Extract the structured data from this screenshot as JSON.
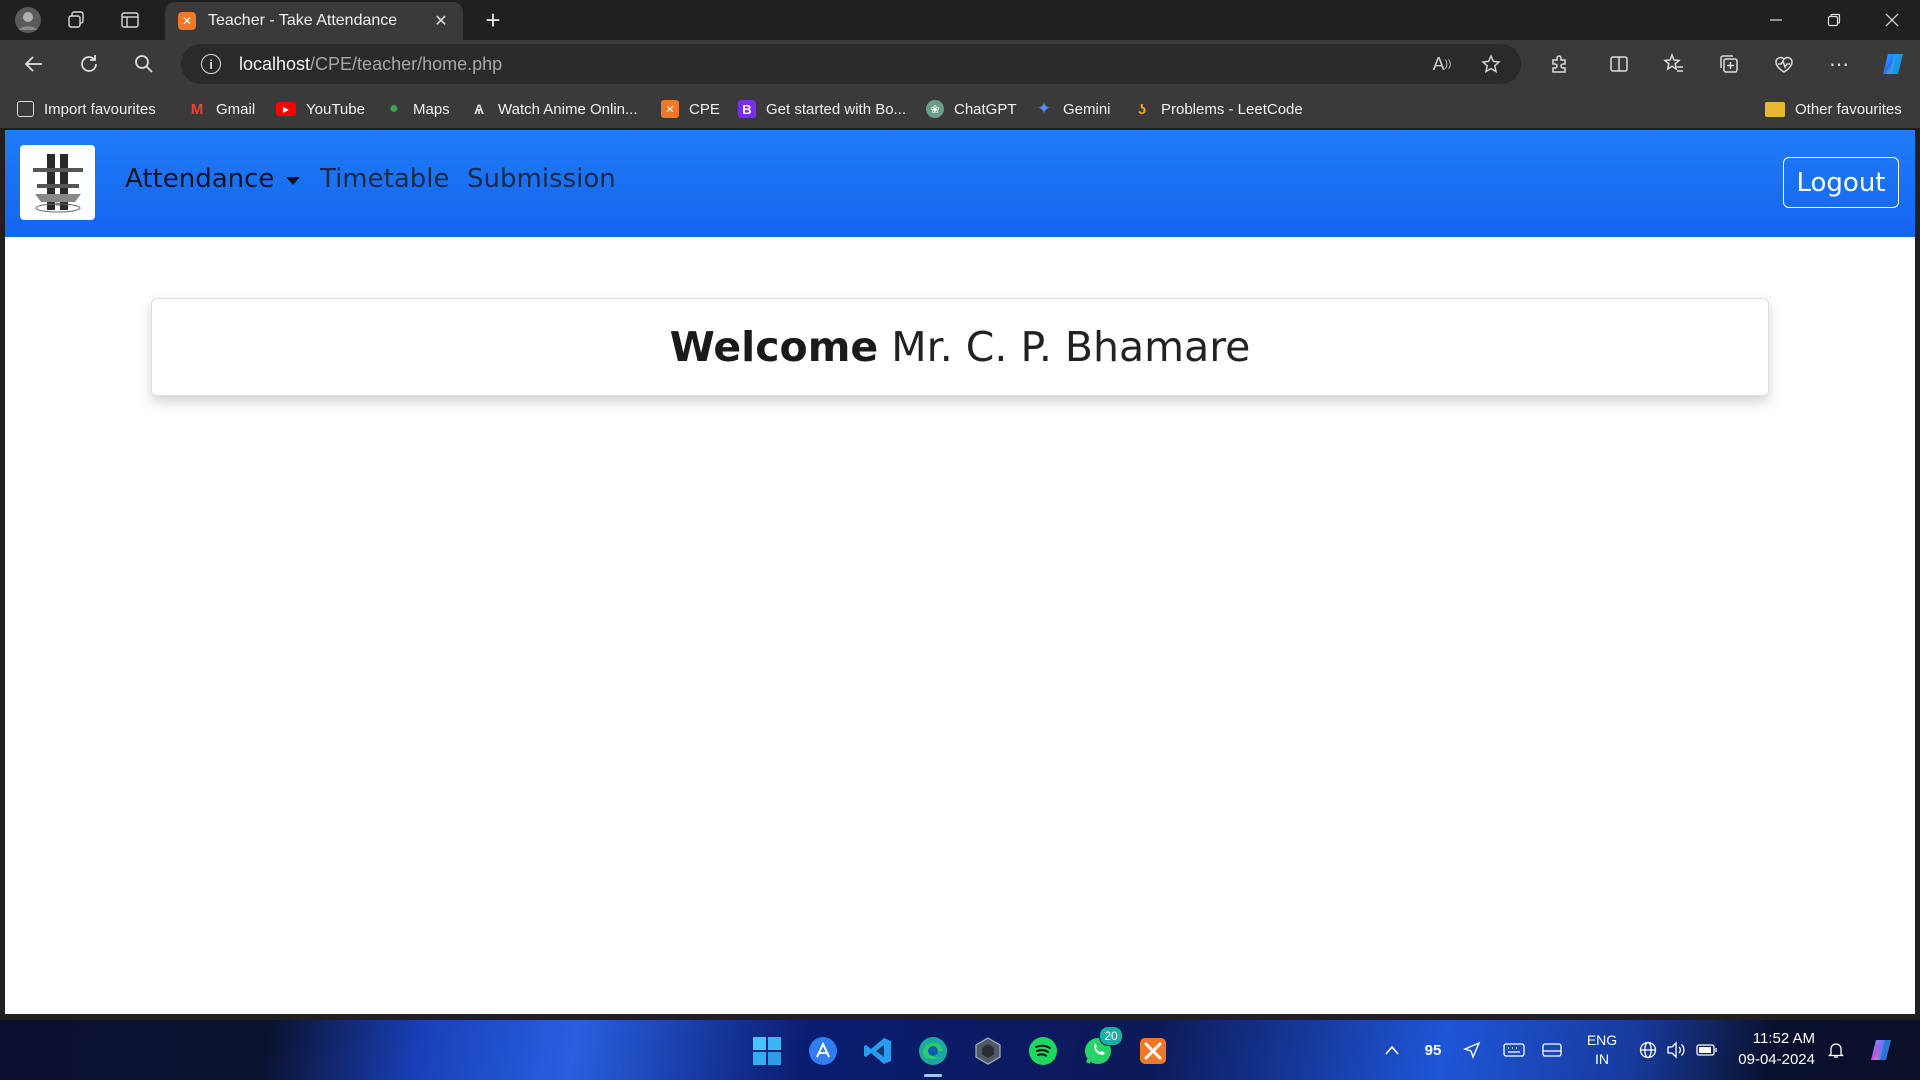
{
  "browser": {
    "tab": {
      "title": "Teacher - Take Attendance",
      "favicon": "xampp-icon"
    },
    "url": {
      "host": "localhost",
      "path": "/CPE/teacher/home.php"
    },
    "bookmarks": [
      {
        "label": "Import favourites",
        "icon": "import-icon"
      },
      {
        "label": "Gmail",
        "icon": "gmail-icon"
      },
      {
        "label": "YouTube",
        "icon": "youtube-icon"
      },
      {
        "label": "Maps",
        "icon": "maps-icon"
      },
      {
        "label": "Watch Anime Onlin...",
        "icon": "anime-icon"
      },
      {
        "label": "CPE",
        "icon": "xampp-icon"
      },
      {
        "label": "Get started with Bo...",
        "icon": "bootstrap-icon"
      },
      {
        "label": "ChatGPT",
        "icon": "chatgpt-icon"
      },
      {
        "label": "Gemini",
        "icon": "gemini-icon"
      },
      {
        "label": "Problems - LeetCode",
        "icon": "leetcode-icon"
      }
    ],
    "other_favourites": "Other favourites"
  },
  "page": {
    "nav": {
      "attendance": "Attendance",
      "timetable": "Timetable",
      "submission": "Submission",
      "logout": "Logout"
    },
    "welcome": {
      "bold": "Welcome",
      "name": "Mr. C. P. Bhamare"
    },
    "colors": {
      "navbar": "#1a73f5",
      "logout_border": "#ffffff"
    }
  },
  "taskbar": {
    "whatsapp_badge": "20",
    "tray_number": "95",
    "lang": "ENG",
    "region": "IN",
    "time": "11:52 AM",
    "date": "09-04-2024"
  }
}
